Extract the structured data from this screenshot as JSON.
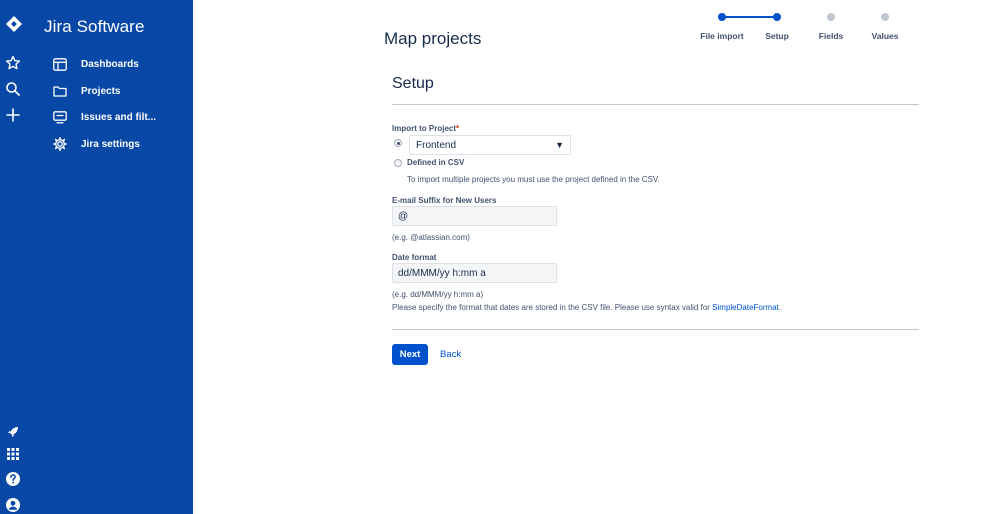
{
  "sidebar": {
    "brand": "Jira Software",
    "nav": [
      {
        "label": "Dashboards"
      },
      {
        "label": "Projects"
      },
      {
        "label": "Issues and filt..."
      },
      {
        "label": "Jira settings"
      }
    ]
  },
  "header": {
    "title": "Map projects"
  },
  "steps": [
    {
      "label": "File import",
      "state": "done"
    },
    {
      "label": "Setup",
      "state": "current"
    },
    {
      "label": "Fields",
      "state": "pending"
    },
    {
      "label": "Values",
      "state": "pending"
    }
  ],
  "form": {
    "section_title": "Setup",
    "import_label": "Import to Project",
    "required_mark": "*",
    "project_select_value": "Frontend",
    "defined_in_csv_label": "Defined in CSV",
    "defined_in_csv_help": "To import multiple projects you must use the project defined in the CSV.",
    "email_label": "E-mail Suffix for New Users",
    "email_value": "@",
    "email_help": "(e.g. @atlassian.com)",
    "date_label": "Date format",
    "date_value": "dd/MMM/yy h:mm a",
    "date_help_example": "(e.g. dd/MMM/yy h:mm a)",
    "date_help_text": "Please specify the format that dates are stored in the CSV file. Please use syntax valid for ",
    "date_help_link": "SimpleDateFormat",
    "date_help_end": "."
  },
  "actions": {
    "next_label": "Next",
    "back_label": "Back"
  },
  "colors": {
    "sidebar_bg": "#0747a6",
    "primary": "#0052cc",
    "step_pending": "#c1c7d0"
  }
}
